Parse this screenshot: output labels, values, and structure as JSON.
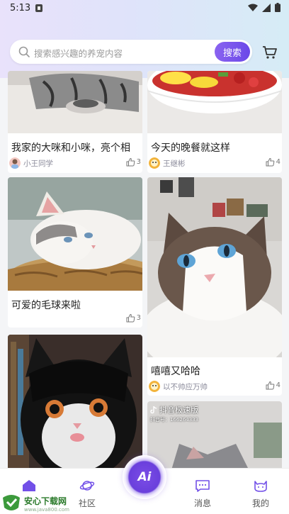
{
  "status": {
    "time": "5:13"
  },
  "search": {
    "placeholder": "搜索感兴趣的养宠内容",
    "button": "搜索"
  },
  "feed": {
    "cards": [
      {
        "title": "我家的大咪和小咪，亮个相",
        "author": "小王同学",
        "likes": "3"
      },
      {
        "title": "今天的晚餐就这样",
        "author": "王继彬",
        "likes": "4"
      },
      {
        "title": "可爱的毛球来啦",
        "author": "",
        "likes": "3"
      },
      {
        "title": "嘻嘻又哈哈",
        "author": "以不帅应万帅",
        "likes": "4"
      },
      {
        "title": "",
        "author": "",
        "likes": ""
      },
      {
        "title": "",
        "author": "",
        "likes": "",
        "overlay_brand": "抖音极速版",
        "overlay_id": "抖音号：166264333"
      }
    ]
  },
  "nav": {
    "items": [
      {
        "label": ""
      },
      {
        "label": "社区"
      },
      {
        "label": "消息"
      },
      {
        "label": "我的"
      }
    ],
    "ai_label": "Ai"
  },
  "watermark": {
    "title": "安心下载网",
    "url": "www.java800.com"
  },
  "colors": {
    "accent": "#7250e8",
    "background": "#f4f5f7"
  }
}
